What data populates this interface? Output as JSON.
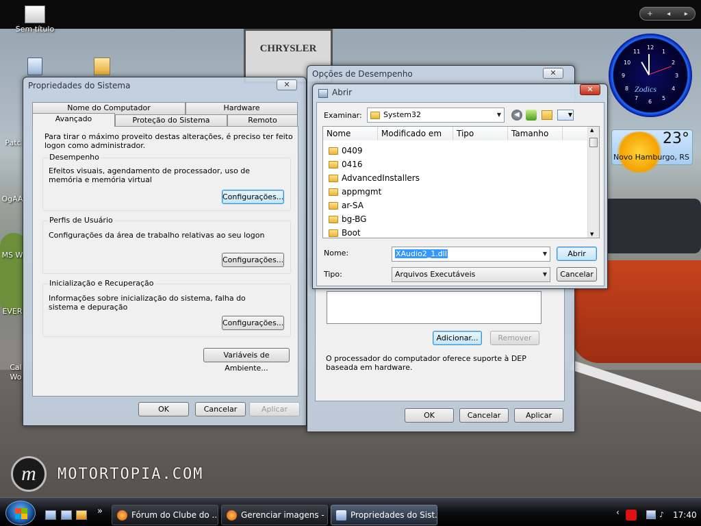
{
  "desktop": {
    "icons": [
      {
        "label": "Sem título"
      },
      {
        "label": "Patc"
      },
      {
        "label": "OgAA"
      },
      {
        "label": "MS W"
      },
      {
        "label": "EVER"
      },
      {
        "label": "Cal"
      },
      {
        "label": "Wo"
      }
    ],
    "background_text": {
      "sign": "CHRYSLER",
      "watermark": "MOTORTOPIA.COM",
      "logo_glyph": "m"
    }
  },
  "sidebar": {
    "controls": [
      "+",
      "◂",
      "▸"
    ],
    "clock": {
      "brand": "Zodics",
      "numbers": [
        "12",
        "1",
        "2",
        "3",
        "4",
        "5",
        "6",
        "7",
        "8",
        "9",
        "10",
        "11"
      ]
    },
    "weather": {
      "temperature": "23°",
      "city": "Novo Hamburgo, RS"
    }
  },
  "system_properties": {
    "title": "Propriedades do Sistema",
    "close": "✕",
    "tabs_back": [
      "Nome do Computador",
      "Hardware"
    ],
    "tabs_front": [
      "Avançado",
      "Proteção do Sistema",
      "Remoto"
    ],
    "active_tab": "Avançado",
    "intro": "Para tirar o máximo proveito destas alterações, é preciso ter feito logon como administrador.",
    "groups": [
      {
        "label": "Desempenho",
        "text": "Efeitos visuais, agendamento de processador, uso de memória e memória virtual",
        "button": "Configurações..."
      },
      {
        "label": "Perfis de Usuário",
        "text": "Configurações da área de trabalho relativas ao seu logon",
        "button": "Configurações..."
      },
      {
        "label": "Inicialização e Recuperação",
        "text": "Informações sobre inicialização do sistema, falha do sistema e depuração",
        "button": "Configurações..."
      }
    ],
    "env_button": "Variáveis de Ambiente...",
    "ok": "OK",
    "cancel": "Cancelar",
    "apply": "Aplicar"
  },
  "performance_options": {
    "title": "Opções de Desempenho",
    "close": "✕",
    "add_button": "Adicionar...",
    "remove_button": "Remover",
    "dep_text": "O processador do computador oferece suporte à DEP baseada em hardware.",
    "ok": "OK",
    "cancel": "Cancelar",
    "apply": "Aplicar"
  },
  "open_dialog": {
    "title": "Abrir",
    "close": "✕",
    "lookin_label": "Examinar:",
    "lookin_value": "System32",
    "columns": [
      "Nome",
      "Modificado em",
      "Tipo",
      "Tamanho"
    ],
    "files": [
      "0409",
      "0416",
      "AdvancedInstallers",
      "appmgmt",
      "ar-SA",
      "bg-BG",
      "Boot"
    ],
    "name_label": "Nome:",
    "name_value": "XAudio2_1.dll",
    "type_label": "Tipo:",
    "type_value": "Arquivos Executáveis",
    "open_button": "Abrir",
    "cancel_button": "Cancelar"
  },
  "taskbar": {
    "buttons": [
      {
        "label": "Fórum do Clube do ..."
      },
      {
        "label": "Gerenciar imagens - ..."
      },
      {
        "label": "Propriedades do Sist..."
      }
    ],
    "overflow": "»",
    "tray_chevron": "‹",
    "time": "17:40"
  }
}
